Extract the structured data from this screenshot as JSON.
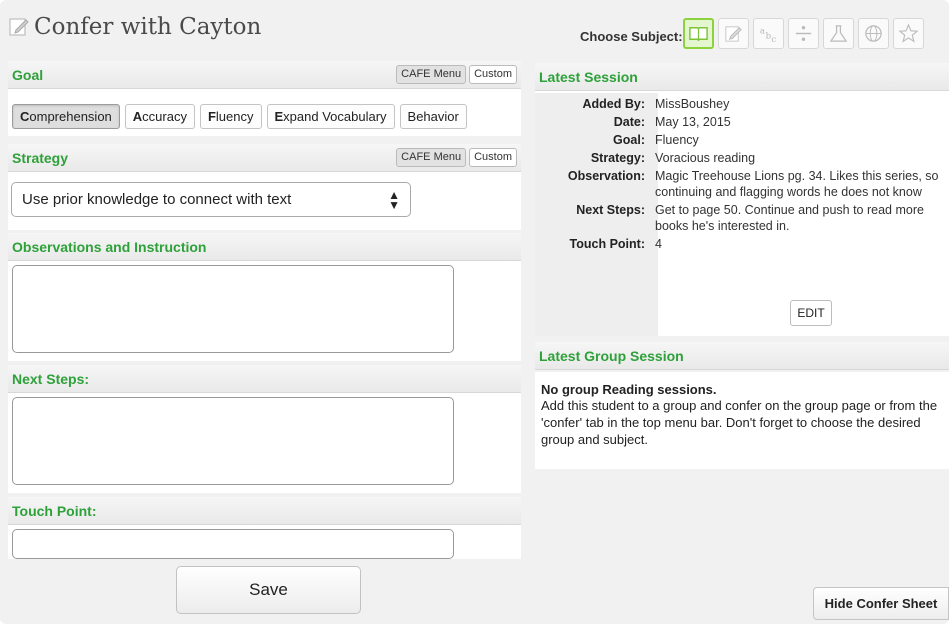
{
  "header": {
    "title": "Confer with Cayton",
    "choose_subject_label": "Choose Subject:",
    "subjects": [
      {
        "icon": "book-icon",
        "active": true
      },
      {
        "icon": "writing-icon",
        "active": false
      },
      {
        "icon": "abc-icon",
        "active": false
      },
      {
        "icon": "divide-icon",
        "active": false
      },
      {
        "icon": "flask-icon",
        "active": false
      },
      {
        "icon": "globe-icon",
        "active": false
      },
      {
        "icon": "star-icon",
        "active": false
      }
    ]
  },
  "goal": {
    "label": "Goal",
    "cafe_menu": "CAFE Menu",
    "custom": "Custom",
    "options": [
      {
        "first": "C",
        "rest": "omprehension"
      },
      {
        "first": "A",
        "rest": "ccuracy"
      },
      {
        "first": "F",
        "rest": "luency"
      },
      {
        "first": "E",
        "rest": "xpand Vocabulary"
      },
      {
        "first": "",
        "rest": "Behavior"
      }
    ],
    "selected_index": 0
  },
  "strategy": {
    "label": "Strategy",
    "cafe_menu": "CAFE Menu",
    "custom": "Custom",
    "selected": "Use prior knowledge to connect with text"
  },
  "observations": {
    "label": "Observations and Instruction",
    "value": ""
  },
  "next_steps": {
    "label": "Next Steps:",
    "value": ""
  },
  "touch_point": {
    "label": "Touch Point:",
    "value": ""
  },
  "save_label": "Save",
  "latest_session": {
    "label": "Latest Session",
    "rows": [
      {
        "key": "Added By:",
        "value": "MissBoushey"
      },
      {
        "key": "Date:",
        "value": "May 13, 2015"
      },
      {
        "key": "Goal:",
        "value": "Fluency"
      },
      {
        "key": "Strategy:",
        "value": "Voracious reading"
      },
      {
        "key": "Observation:",
        "value": "Magic Treehouse Lions pg. 34. Likes this series, so continuing and flagging words he does not know"
      },
      {
        "key": "Next Steps:",
        "value": "Get to page 50. Continue and push to read more books he's interested in."
      },
      {
        "key": "Touch Point:",
        "value": "4"
      }
    ],
    "edit_label": "EDIT"
  },
  "latest_group_session": {
    "label": "Latest Group Session",
    "title": "No group Reading sessions.",
    "text": "Add this student to a group and confer on the group page or from the 'confer' tab in the top menu bar. Don't forget to choose the desired group and subject."
  },
  "hide_label": "Hide Confer Sheet",
  "colors": {
    "accent_green": "#2ea13a",
    "active_subject": "#8bd23c"
  }
}
